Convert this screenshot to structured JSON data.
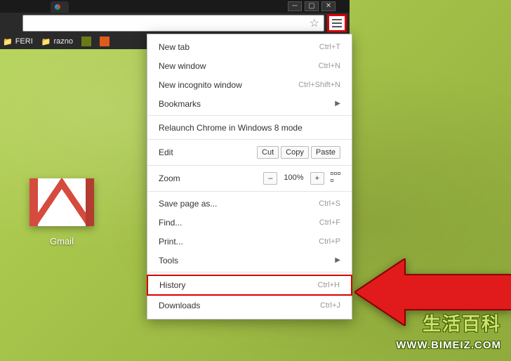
{
  "bookmarks": {
    "items": [
      {
        "label": "FERI"
      },
      {
        "label": "razno"
      }
    ]
  },
  "desktop": {
    "gmail_label": "Gmail"
  },
  "menu": {
    "new_tab": {
      "label": "New tab",
      "shortcut": "Ctrl+T"
    },
    "new_window": {
      "label": "New window",
      "shortcut": "Ctrl+N"
    },
    "new_incognito": {
      "label": "New incognito window",
      "shortcut": "Ctrl+Shift+N"
    },
    "bookmarks": {
      "label": "Bookmarks"
    },
    "relaunch": {
      "label": "Relaunch Chrome in Windows 8 mode"
    },
    "edit": {
      "label": "Edit",
      "cut": "Cut",
      "copy": "Copy",
      "paste": "Paste"
    },
    "zoom": {
      "label": "Zoom",
      "minus": "–",
      "value": "100%",
      "plus": "+"
    },
    "save_as": {
      "label": "Save page as...",
      "shortcut": "Ctrl+S"
    },
    "find": {
      "label": "Find...",
      "shortcut": "Ctrl+F"
    },
    "print": {
      "label": "Print...",
      "shortcut": "Ctrl+P"
    },
    "tools": {
      "label": "Tools"
    },
    "history": {
      "label": "History",
      "shortcut": "Ctrl+H"
    },
    "downloads": {
      "label": "Downloads",
      "shortcut": "Ctrl+J"
    }
  },
  "watermark": {
    "line1": "生活百科",
    "line2": "WWW.BIMEIZ.COM"
  }
}
